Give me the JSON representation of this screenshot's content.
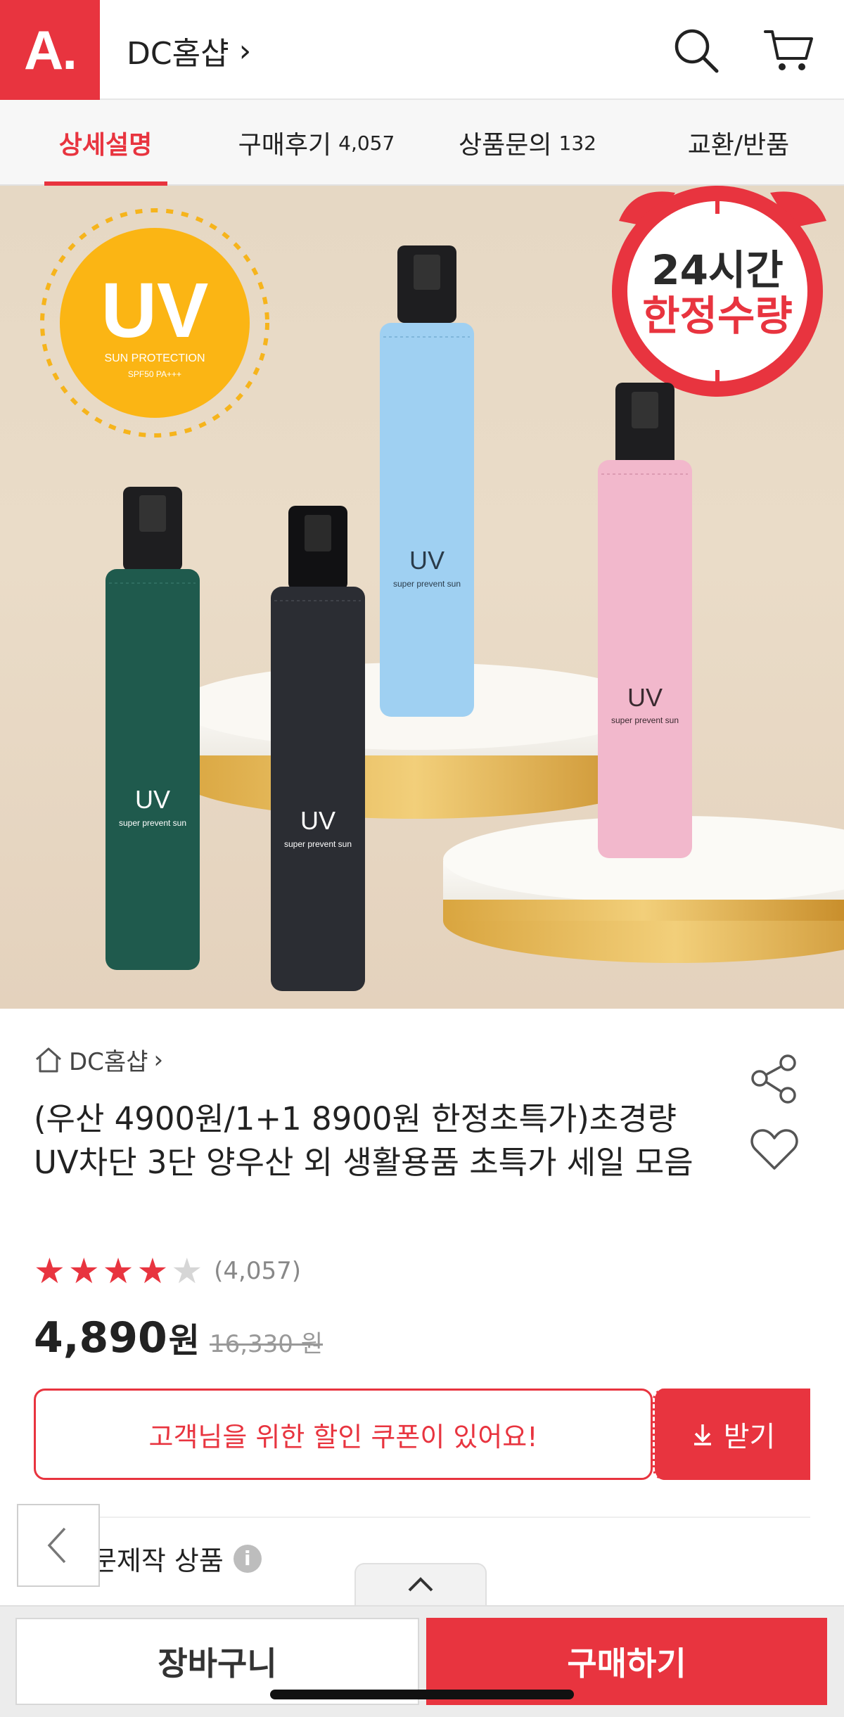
{
  "header": {
    "logo_text": "A.",
    "store_name": "DC홈샵",
    "store_chevron": "›",
    "search_icon": "search-icon",
    "cart_icon": "cart-icon"
  },
  "tabs": [
    {
      "label": "상세설명",
      "count": ""
    },
    {
      "label": "구매후기",
      "count": "4,057"
    },
    {
      "label": "상품문의",
      "count": "132"
    },
    {
      "label": "교환/반품",
      "count": ""
    }
  ],
  "hero": {
    "badge_uv": "UV",
    "badge_sub": "SUN PROTECTION",
    "badge_sub2": "SPF50  PA+++",
    "timer_line1": "24시간",
    "timer_line2": "한정수량",
    "umbrella_label": "UV",
    "umbrella_sub": "super prevent sun",
    "colors": {
      "green": "#1f5a4d",
      "black": "#2b2d33",
      "blue": "#9fd0f2",
      "pink": "#f2b8cc"
    }
  },
  "product": {
    "store": "DC홈샵",
    "store_chevron": "›",
    "title": "(우산 4900원/1+1 8900원 한정초특가)초경량 UV차단 3단 양우산 외 생활용품 초특가 세일 모음",
    "rating": 4,
    "rating_max": 5,
    "rating_count": "(4,057)",
    "price": "4,890",
    "price_unit": "원",
    "original_price": "16,330 원"
  },
  "coupon": {
    "message": "고객님을 위한 할인 쿠폰이 있어요!",
    "button_label": "받기"
  },
  "made_to_order": "주문제작 상품",
  "bottom": {
    "cart_label": "장바구니",
    "buy_label": "구매하기"
  },
  "accent_color": "#e8343f"
}
